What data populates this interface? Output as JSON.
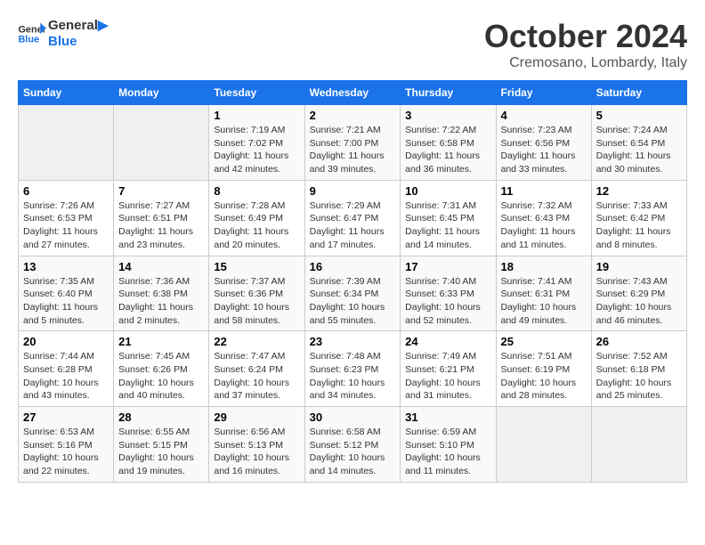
{
  "header": {
    "logo_line1": "General",
    "logo_line2": "Blue",
    "month": "October 2024",
    "location": "Cremosano, Lombardy, Italy"
  },
  "calendar": {
    "weekdays": [
      "Sunday",
      "Monday",
      "Tuesday",
      "Wednesday",
      "Thursday",
      "Friday",
      "Saturday"
    ],
    "rows": [
      [
        {
          "day": "",
          "info": ""
        },
        {
          "day": "",
          "info": ""
        },
        {
          "day": "1",
          "info": "Sunrise: 7:19 AM\nSunset: 7:02 PM\nDaylight: 11 hours and 42 minutes."
        },
        {
          "day": "2",
          "info": "Sunrise: 7:21 AM\nSunset: 7:00 PM\nDaylight: 11 hours and 39 minutes."
        },
        {
          "day": "3",
          "info": "Sunrise: 7:22 AM\nSunset: 6:58 PM\nDaylight: 11 hours and 36 minutes."
        },
        {
          "day": "4",
          "info": "Sunrise: 7:23 AM\nSunset: 6:56 PM\nDaylight: 11 hours and 33 minutes."
        },
        {
          "day": "5",
          "info": "Sunrise: 7:24 AM\nSunset: 6:54 PM\nDaylight: 11 hours and 30 minutes."
        }
      ],
      [
        {
          "day": "6",
          "info": "Sunrise: 7:26 AM\nSunset: 6:53 PM\nDaylight: 11 hours and 27 minutes."
        },
        {
          "day": "7",
          "info": "Sunrise: 7:27 AM\nSunset: 6:51 PM\nDaylight: 11 hours and 23 minutes."
        },
        {
          "day": "8",
          "info": "Sunrise: 7:28 AM\nSunset: 6:49 PM\nDaylight: 11 hours and 20 minutes."
        },
        {
          "day": "9",
          "info": "Sunrise: 7:29 AM\nSunset: 6:47 PM\nDaylight: 11 hours and 17 minutes."
        },
        {
          "day": "10",
          "info": "Sunrise: 7:31 AM\nSunset: 6:45 PM\nDaylight: 11 hours and 14 minutes."
        },
        {
          "day": "11",
          "info": "Sunrise: 7:32 AM\nSunset: 6:43 PM\nDaylight: 11 hours and 11 minutes."
        },
        {
          "day": "12",
          "info": "Sunrise: 7:33 AM\nSunset: 6:42 PM\nDaylight: 11 hours and 8 minutes."
        }
      ],
      [
        {
          "day": "13",
          "info": "Sunrise: 7:35 AM\nSunset: 6:40 PM\nDaylight: 11 hours and 5 minutes."
        },
        {
          "day": "14",
          "info": "Sunrise: 7:36 AM\nSunset: 6:38 PM\nDaylight: 11 hours and 2 minutes."
        },
        {
          "day": "15",
          "info": "Sunrise: 7:37 AM\nSunset: 6:36 PM\nDaylight: 10 hours and 58 minutes."
        },
        {
          "day": "16",
          "info": "Sunrise: 7:39 AM\nSunset: 6:34 PM\nDaylight: 10 hours and 55 minutes."
        },
        {
          "day": "17",
          "info": "Sunrise: 7:40 AM\nSunset: 6:33 PM\nDaylight: 10 hours and 52 minutes."
        },
        {
          "day": "18",
          "info": "Sunrise: 7:41 AM\nSunset: 6:31 PM\nDaylight: 10 hours and 49 minutes."
        },
        {
          "day": "19",
          "info": "Sunrise: 7:43 AM\nSunset: 6:29 PM\nDaylight: 10 hours and 46 minutes."
        }
      ],
      [
        {
          "day": "20",
          "info": "Sunrise: 7:44 AM\nSunset: 6:28 PM\nDaylight: 10 hours and 43 minutes."
        },
        {
          "day": "21",
          "info": "Sunrise: 7:45 AM\nSunset: 6:26 PM\nDaylight: 10 hours and 40 minutes."
        },
        {
          "day": "22",
          "info": "Sunrise: 7:47 AM\nSunset: 6:24 PM\nDaylight: 10 hours and 37 minutes."
        },
        {
          "day": "23",
          "info": "Sunrise: 7:48 AM\nSunset: 6:23 PM\nDaylight: 10 hours and 34 minutes."
        },
        {
          "day": "24",
          "info": "Sunrise: 7:49 AM\nSunset: 6:21 PM\nDaylight: 10 hours and 31 minutes."
        },
        {
          "day": "25",
          "info": "Sunrise: 7:51 AM\nSunset: 6:19 PM\nDaylight: 10 hours and 28 minutes."
        },
        {
          "day": "26",
          "info": "Sunrise: 7:52 AM\nSunset: 6:18 PM\nDaylight: 10 hours and 25 minutes."
        }
      ],
      [
        {
          "day": "27",
          "info": "Sunrise: 6:53 AM\nSunset: 5:16 PM\nDaylight: 10 hours and 22 minutes."
        },
        {
          "day": "28",
          "info": "Sunrise: 6:55 AM\nSunset: 5:15 PM\nDaylight: 10 hours and 19 minutes."
        },
        {
          "day": "29",
          "info": "Sunrise: 6:56 AM\nSunset: 5:13 PM\nDaylight: 10 hours and 16 minutes."
        },
        {
          "day": "30",
          "info": "Sunrise: 6:58 AM\nSunset: 5:12 PM\nDaylight: 10 hours and 14 minutes."
        },
        {
          "day": "31",
          "info": "Sunrise: 6:59 AM\nSunset: 5:10 PM\nDaylight: 10 hours and 11 minutes."
        },
        {
          "day": "",
          "info": ""
        },
        {
          "day": "",
          "info": ""
        }
      ]
    ]
  }
}
